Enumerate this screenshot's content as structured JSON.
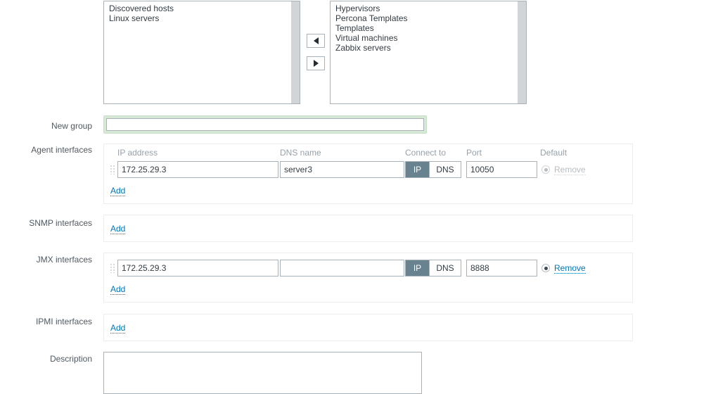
{
  "dual_list": {
    "available": {
      "options": [
        "Discovered hosts",
        "Linux servers"
      ]
    },
    "selected": {
      "options": [
        "Hypervisors",
        "Percona Templates",
        "Templates",
        "Virtual machines",
        "Zabbix servers"
      ]
    },
    "move_left_icon": "triangle-left-icon",
    "move_right_icon": "triangle-right-icon"
  },
  "new_group": {
    "label": "New group",
    "value": "",
    "placeholder": "",
    "focus_ring_color": "#d6e9d6"
  },
  "agent_interfaces": {
    "label": "Agent interfaces",
    "columns": {
      "ip": "IP address",
      "dns": "DNS name",
      "connect_to": "Connect to",
      "port": "Port",
      "default": "Default"
    },
    "rows": [
      {
        "ip": "172.25.29.3",
        "dns": "server3",
        "connect_to": "IP",
        "connect_options": [
          "IP",
          "DNS"
        ],
        "port": "10050",
        "default_selected": true,
        "remove_label": "Remove",
        "remove_disabled": true
      }
    ],
    "add_label": "Add"
  },
  "snmp_interfaces": {
    "label": "SNMP interfaces",
    "rows": [],
    "add_label": "Add"
  },
  "jmx_interfaces": {
    "label": "JMX interfaces",
    "rows": [
      {
        "ip": "172.25.29.3",
        "dns": "",
        "connect_to": "IP",
        "connect_options": [
          "IP",
          "DNS"
        ],
        "port": "8888",
        "default_selected": true,
        "remove_label": "Remove",
        "remove_disabled": false
      }
    ],
    "add_label": "Add"
  },
  "ipmi_interfaces": {
    "label": "IPMI interfaces",
    "rows": [],
    "add_label": "Add"
  },
  "description": {
    "label": "Description",
    "value": "",
    "placeholder": ""
  },
  "colors": {
    "link": "#0275b8",
    "segment_active": "#68828f",
    "label_text": "#4f5861",
    "column_header": "#97a1a9",
    "panel_border": "#ebeef0"
  }
}
